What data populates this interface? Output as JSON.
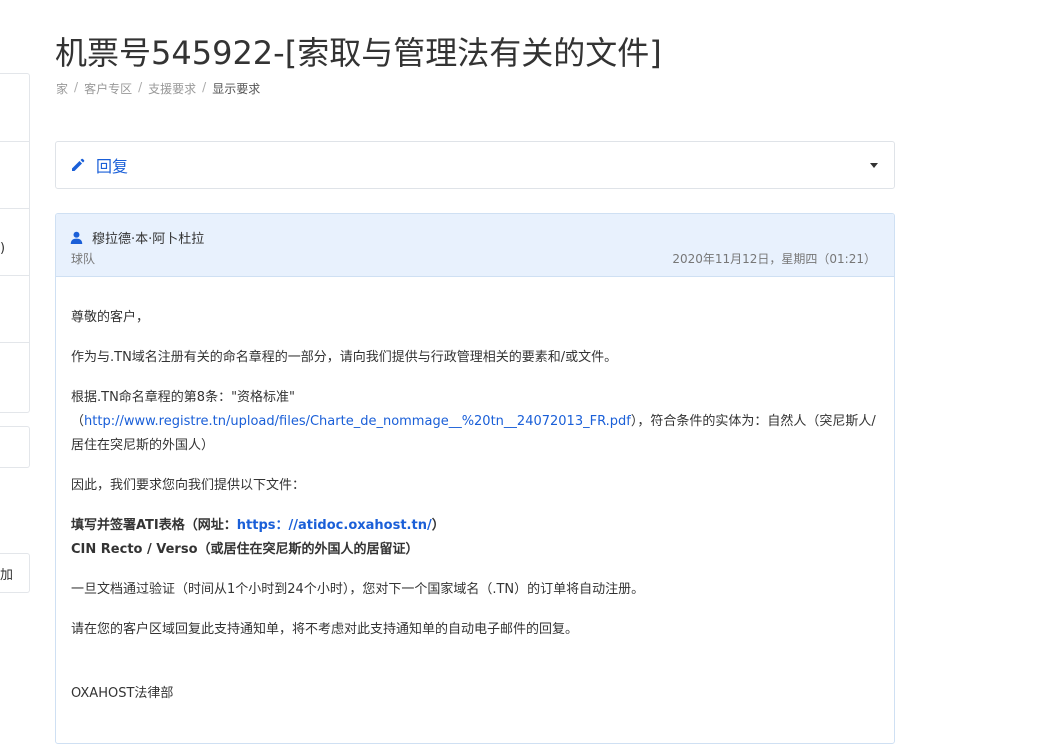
{
  "page": {
    "title": "机票号545922-[索取与管理法有关的文件]"
  },
  "breadcrumb": {
    "items": [
      "家",
      "客户专区",
      "支援要求",
      "显示要求"
    ],
    "separator": "/"
  },
  "sidebar": {
    "fragment_paren": ")",
    "fragment_add": "加"
  },
  "reply": {
    "label": "回复",
    "icon": "pencil-icon",
    "caret_icon": "caret-down-icon"
  },
  "message": {
    "author": "穆拉德·本·阿卜杜拉",
    "role": "球队",
    "date": "2020年11月12日，星期四（01:21）",
    "user_icon": "user-icon",
    "header_color": "#e8f1fd",
    "link_color": "#1a5fd8",
    "body": {
      "greeting": "尊敬的客户，",
      "p1": "作为与.TN域名注册有关的命名章程的一部分，请向我们提供与行政管理相关的要素和/或文件。",
      "p2_prefix": "根据.TN命名章程的第8条：\"资格标准\"",
      "p2_open": "（",
      "p2_link": "http://www.registre.tn/upload/files/Charte_de_nommage__%20tn__24072013_FR.pdf",
      "p2_suffix": "），符合条件的实体为：自然人（突尼斯人/居住在突尼斯的外国人）",
      "p3": "因此，我们要求您向我们提供以下文件：",
      "item1_prefix": "填写并签署ATI表格（网址：",
      "item1_link": "https：//atidoc.oxahost.tn/",
      "item1_suffix": "）",
      "item2": "CIN Recto / Verso（或居住在突尼斯的外国人的居留证）",
      "p4": "一旦文档通过验证（时间从1个小时到24个小时），您对下一个国家域名（.TN）的订单将自动注册。",
      "p5": "请在您的客户区域回复此支持通知单，将不考虑对此支持通知单的自动电子邮件的回复。",
      "signature": "OXAHOST法律部"
    }
  }
}
